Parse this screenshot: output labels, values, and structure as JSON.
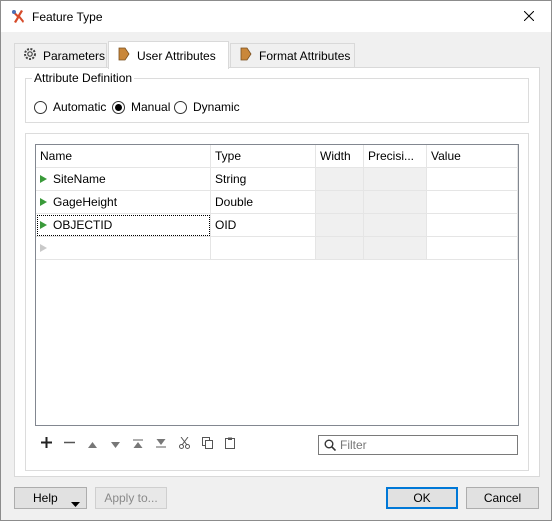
{
  "window": {
    "title": "Feature Type",
    "icons": {
      "app": "fme-wrench-icon",
      "close": "close-icon"
    }
  },
  "tabs": [
    {
      "label": "Parameters",
      "icon": "gear-icon",
      "active": false
    },
    {
      "label": "User Attributes",
      "icon": "tag-icon",
      "active": true
    },
    {
      "label": "Format Attributes",
      "icon": "tag-icon",
      "active": false
    }
  ],
  "attribute_definition": {
    "legend": "Attribute Definition",
    "options": [
      "Automatic",
      "Manual",
      "Dynamic"
    ],
    "selected": "Manual"
  },
  "table": {
    "columns": [
      "Name",
      "Type",
      "Width",
      "Precisi...",
      "Value"
    ],
    "rows": [
      {
        "name": "SiteName",
        "type": "String",
        "width": "",
        "precision": "",
        "value": ""
      },
      {
        "name": "GageHeight",
        "type": "Double",
        "width": "",
        "precision": "",
        "value": ""
      },
      {
        "name": "OBJECTID",
        "type": "OID",
        "width": "",
        "precision": "",
        "value": ""
      }
    ]
  },
  "toolbar": {
    "buttons": [
      "add-icon",
      "remove-icon",
      "move-up-icon",
      "move-down-icon",
      "move-top-icon",
      "move-bottom-icon",
      "cut-icon",
      "copy-icon",
      "paste-icon"
    ]
  },
  "filter": {
    "placeholder": "Filter",
    "value": ""
  },
  "footer": {
    "help": "Help",
    "apply": "Apply to...",
    "ok": "OK",
    "cancel": "Cancel"
  }
}
